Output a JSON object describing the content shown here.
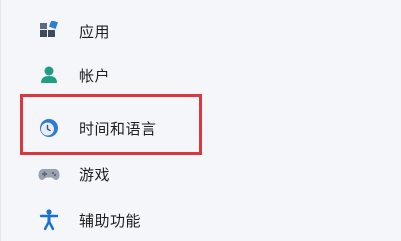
{
  "nav": {
    "items": [
      {
        "label": "应用",
        "icon": "apps-icon"
      },
      {
        "label": "帐户",
        "icon": "account-icon"
      },
      {
        "label": "时间和语言",
        "icon": "time-language-icon"
      },
      {
        "label": "游戏",
        "icon": "gamepad-icon"
      },
      {
        "label": "辅助功能",
        "icon": "accessibility-icon"
      }
    ]
  },
  "colors": {
    "highlight": "#d9393d",
    "accent": "#2e7bd1",
    "account_green": "#1f9e83"
  }
}
